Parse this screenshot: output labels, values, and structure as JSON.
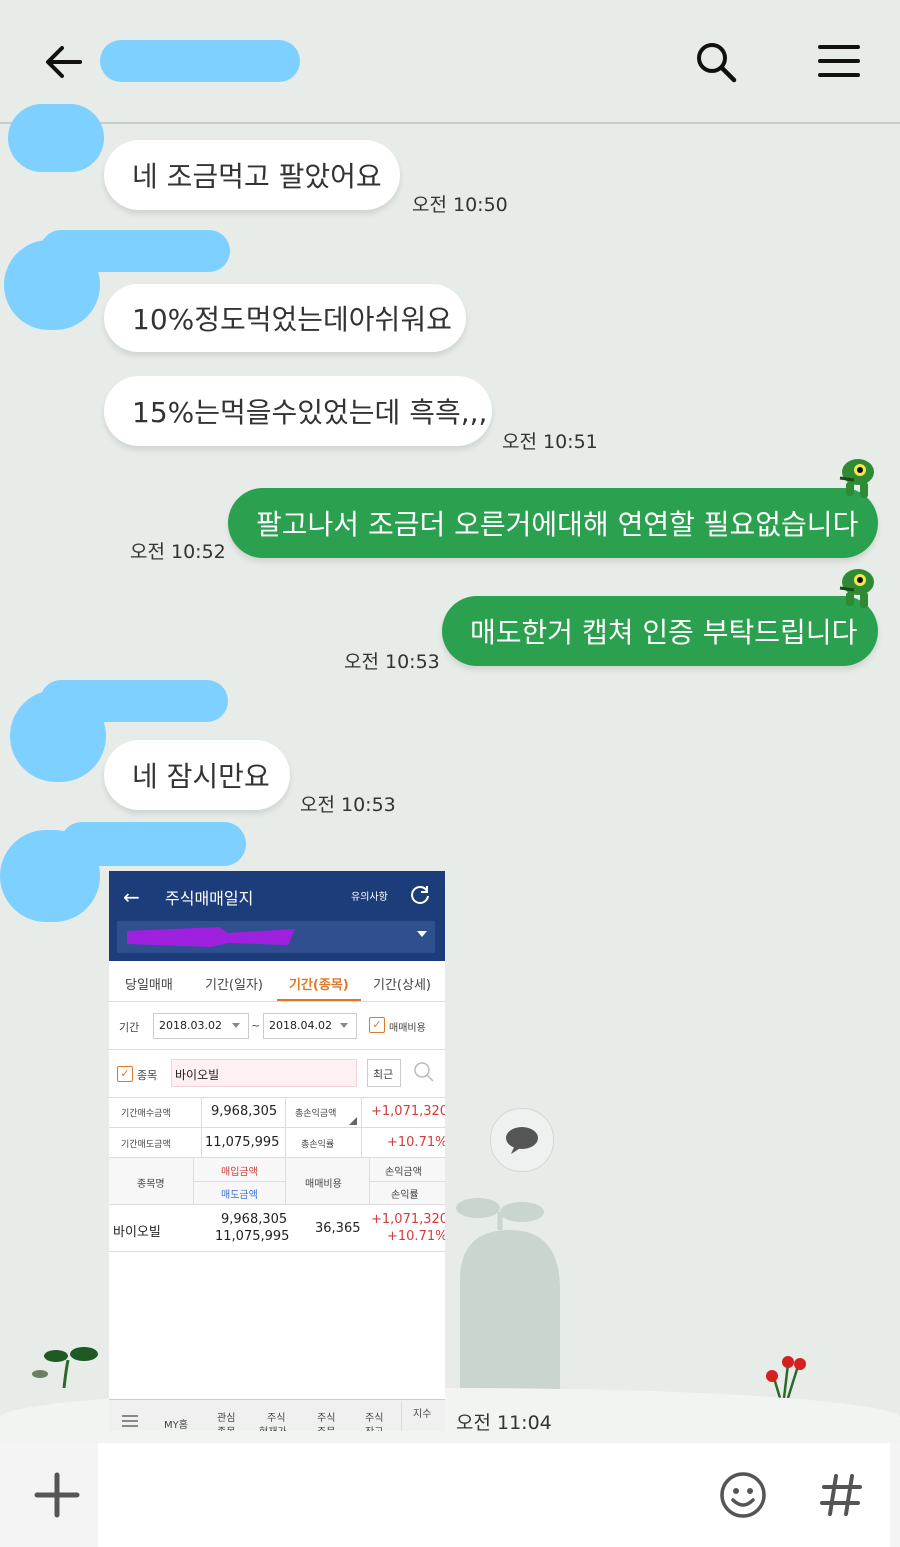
{
  "header": {
    "back_icon": "arrow-left-icon",
    "search_icon": "search-icon",
    "menu_icon": "hamburger-icon"
  },
  "messages": [
    {
      "text": "네 조금먹고 팔았어요",
      "time": "오전 10:50"
    },
    {
      "text": "10%정도먹었는데아쉬워요"
    },
    {
      "text": "15%는먹을수있었는데 흑흑,,,",
      "time": "오전 10:51"
    },
    {
      "text": "팔고나서 조금더 오른거에대해 연연할 필요없습니다",
      "time": "오전 10:52"
    },
    {
      "text": "매도한거 캡쳐 인증 부탁드립니다",
      "time": "오전 10:53"
    },
    {
      "text": "네 잠시만요",
      "time": "오전 10:53"
    },
    {
      "time": "오전 11:04"
    }
  ],
  "shot": {
    "title": "주식매매일지",
    "notice": "유의사항",
    "tabs": [
      "당일매매",
      "기간(일자)",
      "기간(종목)",
      "기간(상세)"
    ],
    "period_label": "기간",
    "date_from": "2018.03.02",
    "tilde": "~",
    "date_to": "2018.04.02",
    "fee_check": "매매비용",
    "item_label": "종목",
    "item_value": "바이오빌",
    "recent_btn": "최근",
    "sum": {
      "buy_label": "기간매수금액",
      "buy_value": "9,968,305",
      "pl_label": "총손익금액",
      "pl_value": "+1,071,320",
      "sell_label": "기간매도금액",
      "sell_value": "11,075,995",
      "rate_label": "총손익률",
      "rate_value": "+10.71%"
    },
    "cols": {
      "name": "종목명",
      "buy": "매입금액",
      "sell": "매도금액",
      "fee": "매매비용",
      "pl": "손익금액",
      "rate": "손익률"
    },
    "row": {
      "name": "바이오빌",
      "buy": "9,968,305",
      "sell": "11,075,995",
      "fee": "36,365",
      "pl": "+1,071,320",
      "rate": "+10.71%"
    },
    "nav": [
      "MY홈",
      "관심",
      "주식",
      "주식",
      "주식",
      "지수"
    ],
    "nav2": [
      "종목",
      "현재가",
      "주문",
      "잔고"
    ]
  },
  "input": {
    "plus_icon": "plus-icon",
    "emoji_icon": "smiley-icon",
    "hash_icon": "hash-icon"
  },
  "colors": {
    "bg": "#e8ece9",
    "mine": "#2ba14f",
    "theirs": "#ffffff",
    "redact": "#7dd0ff"
  }
}
